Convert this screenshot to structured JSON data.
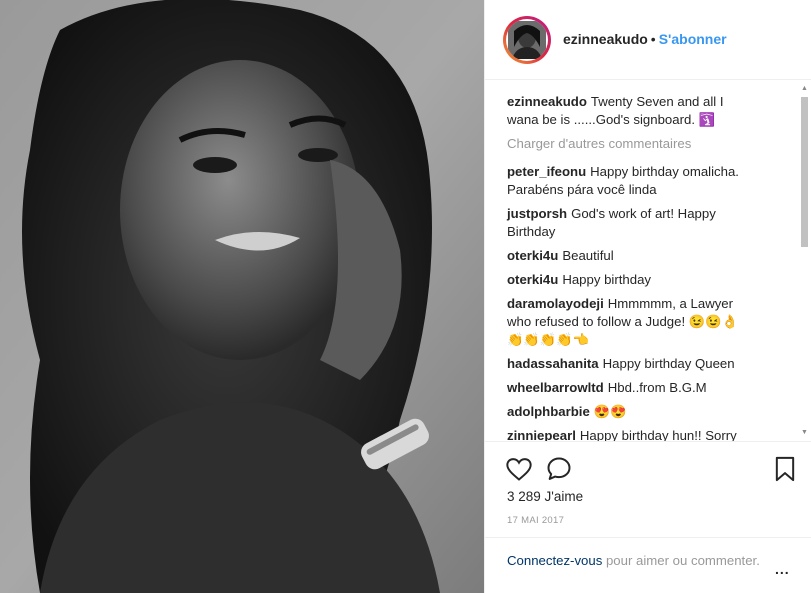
{
  "post": {
    "image_description_icon": "portrait-photo"
  },
  "header": {
    "username": "ezinneakudo",
    "separator": "•",
    "follow_label": "S'abonner"
  },
  "caption": {
    "user": "ezinneakudo",
    "text": "Twenty Seven and all I wana be is ......God's signboard. 🛐"
  },
  "load_more_label": "Charger d'autres commentaires",
  "comments": [
    {
      "user": "peter_ifeonu",
      "text": "Happy birthday omalicha. Parabéns pára você linda"
    },
    {
      "user": "justporsh",
      "text": "God's work of art! Happy Birthday"
    },
    {
      "user": "oterki4u",
      "text": "Beautiful"
    },
    {
      "user": "oterki4u",
      "text": "Happy birthday"
    },
    {
      "user": "daramolayodeji",
      "text": "Hmmmmm, a Lawyer who refused to follow a Judge! 😉😉👌👏👏👏👏👈"
    },
    {
      "user": "hadassahanita",
      "text": "Happy birthday Queen"
    },
    {
      "user": "wheelbarrowltd",
      "text": "Hbd..from B.G.M"
    },
    {
      "user": "adolphbarbie",
      "text": "😍😍"
    },
    {
      "user": "zinniepearl",
      "text": "Happy birthday hun!! Sorry its"
    }
  ],
  "actions": {
    "likes": "3 289 J'aime",
    "date": "17 MAI 2017"
  },
  "login": {
    "link_label": "Connectez-vous",
    "rest_text": " pour aimer ou commenter.",
    "more_label": "..."
  },
  "colors": {
    "accent": "#3897f0",
    "muted": "#999999",
    "text": "#262626"
  }
}
